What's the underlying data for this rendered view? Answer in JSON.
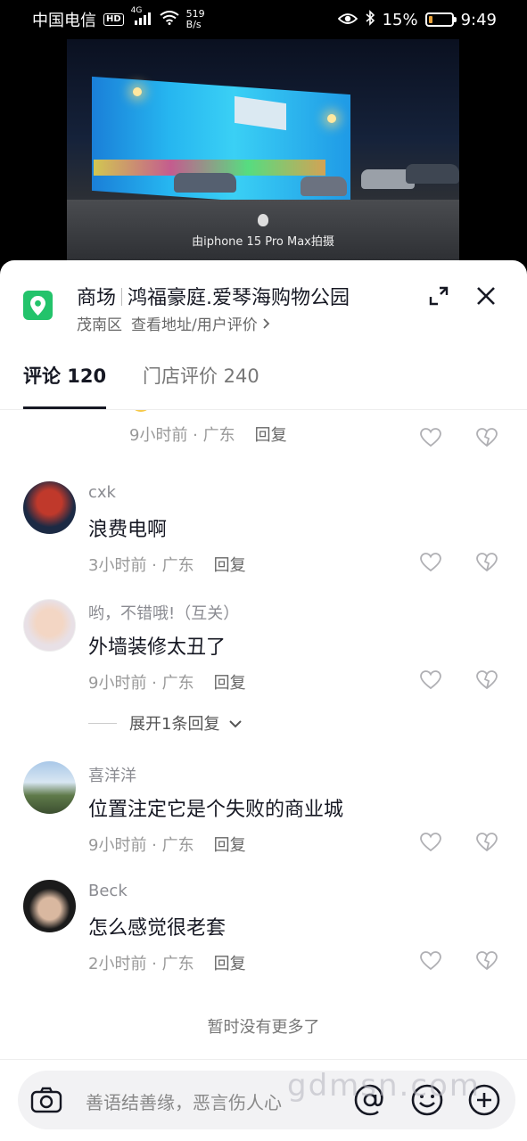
{
  "status_bar": {
    "carrier": "中国电信",
    "hd": "HD",
    "signal": "4G",
    "net_speed_value": "519",
    "net_speed_unit": "B/s",
    "battery": "15%",
    "battery_level": 0.15,
    "time": "9:49"
  },
  "video": {
    "caption": "由iphone 15 Pro Max拍摄"
  },
  "poi": {
    "category": "商场",
    "name": "鸿福豪庭.爱琴海购物公园",
    "district": "茂南区",
    "link": "查看地址/用户评价"
  },
  "tabs": [
    {
      "label": "评论 120"
    },
    {
      "label": "门店评价 240"
    }
  ],
  "partial_comment": {
    "meta": "9小时前 · 广东",
    "reply": "回复"
  },
  "comments": [
    {
      "user": "cxk",
      "text": "浪费电啊",
      "meta": "3小时前 · 广东",
      "reply": "回复"
    },
    {
      "user": "哟，不错哦!（互关）",
      "text": "外墙装修太丑了",
      "meta": "9小时前 · 广东",
      "reply": "回复",
      "expand": "展开1条回复"
    },
    {
      "user": "喜洋洋",
      "text": "位置注定它是个失败的商业城",
      "meta": "9小时前 · 广东",
      "reply": "回复"
    },
    {
      "user": "Beck",
      "text": "怎么感觉很老套",
      "meta": "2小时前 · 广东",
      "reply": "回复"
    }
  ],
  "end_text": "暂时没有更多了",
  "input": {
    "placeholder": "善语结善缘，恶言伤人心"
  },
  "watermark": "gdmsn.com",
  "colors": {
    "accent": "#23c36b",
    "text": "#161823",
    "meta": "#999999"
  }
}
